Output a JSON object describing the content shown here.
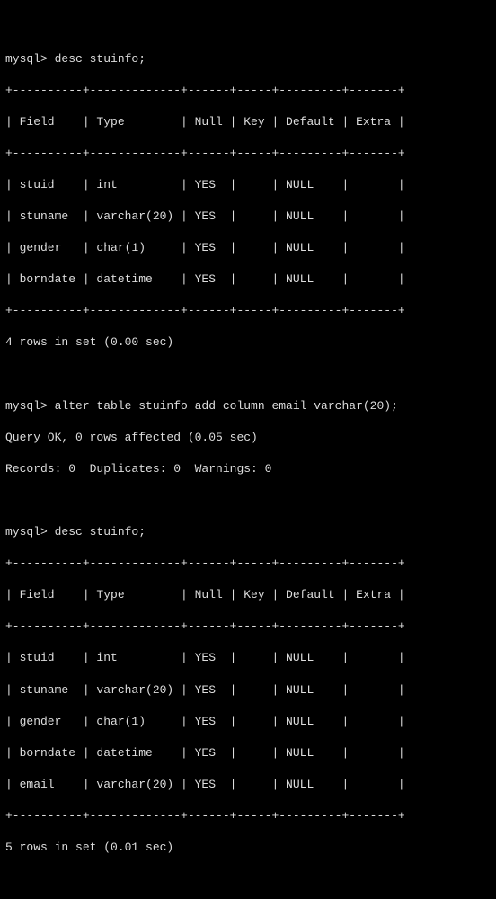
{
  "prompt1": {
    "prefix": "mysql> ",
    "command": "desc stuinfo;"
  },
  "table1": {
    "border": "+----------+-------------+------+-----+---------+-------+",
    "header": "| Field    | Type        | Null | Key | Default | Extra |",
    "rows": [
      "| stuid    | int         | YES  |     | NULL    |       |",
      "| stuname  | varchar(20) | YES  |     | NULL    |       |",
      "| gender   | char(1)     | YES  |     | NULL    |       |",
      "| borndate | datetime    | YES  |     | NULL    |       |"
    ],
    "footer": "4 rows in set (0.00 sec)"
  },
  "prompt2": {
    "prefix": "mysql> ",
    "command": "alter table stuinfo add column email varchar(20);"
  },
  "result2": {
    "line1": "Query OK, 0 rows affected (0.05 sec)",
    "line2": "Records: 0  Duplicates: 0  Warnings: 0"
  },
  "prompt3": {
    "prefix": "mysql> ",
    "command": "desc stuinfo;"
  },
  "table2": {
    "border": "+----------+-------------+------+-----+---------+-------+",
    "header": "| Field    | Type        | Null | Key | Default | Extra |",
    "rows": [
      "| stuid    | int         | YES  |     | NULL    |       |",
      "| stuname  | varchar(20) | YES  |     | NULL    |       |",
      "| gender   | char(1)     | YES  |     | NULL    |       |",
      "| borndate | datetime    | YES  |     | NULL    |       |",
      "| email    | varchar(20) | YES  |     | NULL    |       |"
    ],
    "footer": "5 rows in set (0.01 sec)"
  }
}
